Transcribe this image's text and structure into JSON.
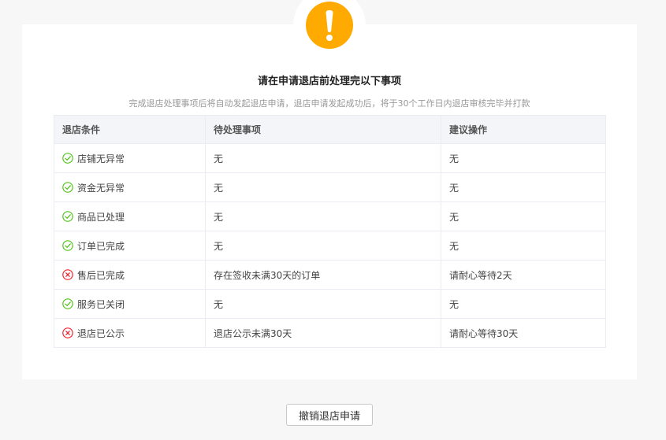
{
  "header": {
    "icon": "exclamation-icon",
    "icon_color": "#ffaa00",
    "title": "请在申请退店前处理完以下事项",
    "subtitle": "完成退店处理事项后将自动发起退店申请，退店申请发起成功后，将于30个工作日内退店审核完毕并打款"
  },
  "table": {
    "columns": [
      "退店条件",
      "待处理事项",
      "建议操作"
    ],
    "rows": [
      {
        "condition": "店铺无异常",
        "status": "ok",
        "pending": "无",
        "action": "无"
      },
      {
        "condition": "资金无异常",
        "status": "ok",
        "pending": "无",
        "action": "无"
      },
      {
        "condition": "商品已处理",
        "status": "ok",
        "pending": "无",
        "action": "无"
      },
      {
        "condition": "订单已完成",
        "status": "ok",
        "pending": "无",
        "action": "无"
      },
      {
        "condition": "售后已完成",
        "status": "fail",
        "pending": "存在签收未满30天的订单",
        "action": "请耐心等待2天"
      },
      {
        "condition": "服务已关闭",
        "status": "ok",
        "pending": "无",
        "action": "无"
      },
      {
        "condition": "退店已公示",
        "status": "fail",
        "pending": "退店公示未满30天",
        "action": "请耐心等待30天"
      }
    ]
  },
  "status_colors": {
    "ok": "#52c41a",
    "fail": "#f5222d"
  },
  "footer": {
    "cancel_label": "撤销退店申请"
  }
}
